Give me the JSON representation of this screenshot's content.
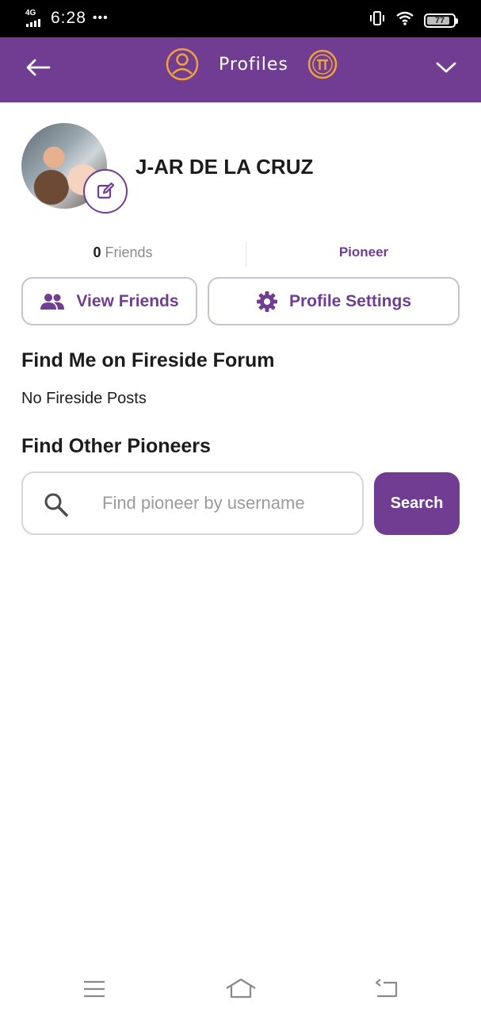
{
  "status_bar": {
    "network": "4G",
    "time": "6:28",
    "dots": "•••",
    "battery_level": "77",
    "icons": [
      "signal-icon",
      "vibrate-icon",
      "wifi-icon",
      "battery-icon"
    ]
  },
  "app_bar": {
    "title": "Profiles",
    "icons": [
      "back-arrow-icon",
      "profile-icon",
      "pi-coin-icon",
      "chevron-down-icon"
    ]
  },
  "profile": {
    "name": "J-AR DE LA CRUZ",
    "icons": [
      "avatar-photo",
      "edit-icon"
    ]
  },
  "stats": {
    "friends_count": "0",
    "friends_label": "Friends",
    "role": "Pioneer"
  },
  "actions": {
    "view_friends": "View Friends",
    "profile_settings": "Profile Settings",
    "icons": [
      "friends-icon",
      "gear-icon"
    ]
  },
  "fireside": {
    "title": "Find Me on Fireside Forum",
    "empty_text": "No Fireside Posts"
  },
  "find_pioneers": {
    "title": "Find Other Pioneers",
    "placeholder": "Find pioneer by username",
    "value": "",
    "search_label": "Search",
    "icons": [
      "search-icon"
    ]
  },
  "nav_bar": {
    "icons": [
      "menu-icon",
      "home-icon",
      "back-icon"
    ]
  },
  "colors": {
    "brand_purple": "#703d92",
    "accent_orange": "#f0a23a",
    "text_dark": "#1c1c1c",
    "muted_gray": "#8a8a8a",
    "border_gray": "#d6d6d6"
  }
}
